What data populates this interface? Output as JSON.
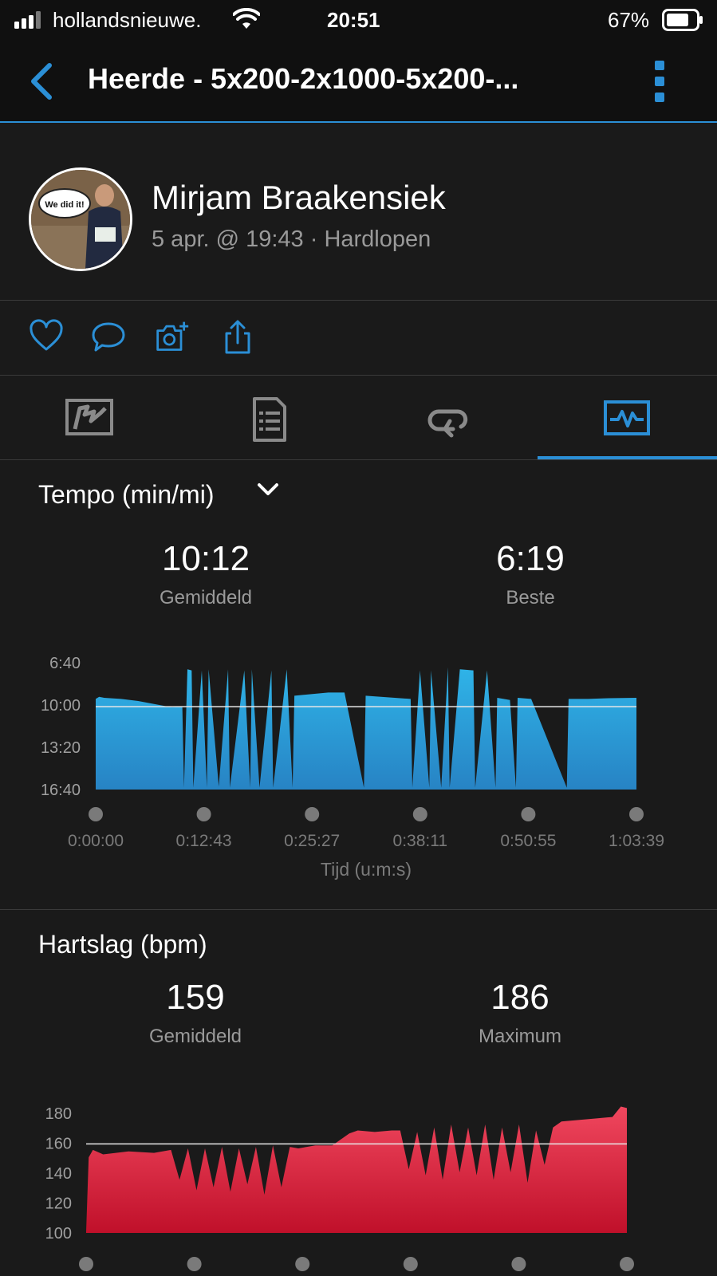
{
  "status_bar": {
    "carrier": "hollandsnieuwe.",
    "time": "20:51",
    "battery": "67%"
  },
  "nav": {
    "title": "Heerde - 5x200-2x1000-5x200-..."
  },
  "activity": {
    "user_name": "Mirjam Braakensiek",
    "meta": "5 apr. @ 19:43 · Hardlopen",
    "avatar_text": "We did it!"
  },
  "actions": [
    "heart-icon",
    "comment-icon",
    "add-photo-icon",
    "share-icon"
  ],
  "tabs": [
    {
      "icon": "activity-map-icon",
      "active": false
    },
    {
      "icon": "details-document-icon",
      "active": false
    },
    {
      "icon": "laps-loop-icon",
      "active": false
    },
    {
      "icon": "charts-icon",
      "active": true
    }
  ],
  "colors": {
    "accent": "#2b8fd6",
    "pace_fill": "#2aa8e0",
    "hr_fill": "#e0263f",
    "background": "#1a1a1a"
  },
  "pace": {
    "title": "Tempo (min/mi)",
    "avg_value": "10:12",
    "avg_label": "Gemiddeld",
    "best_value": "6:19",
    "best_label": "Beste"
  },
  "heart_rate": {
    "title": "Hartslag (bpm)",
    "avg_value": "159",
    "avg_label": "Gemiddeld",
    "max_value": "186",
    "max_label": "Maximum"
  },
  "chart_data": [
    {
      "type": "area",
      "title": "Tempo (min/mi)",
      "xlabel": "Tijd (u:m:s)",
      "ylabel": "",
      "x_ticks": [
        "0:00:00",
        "0:12:43",
        "0:25:27",
        "0:38:11",
        "0:50:55",
        "1:03:39"
      ],
      "y_ticks": [
        "6:40",
        "10:00",
        "13:20",
        "16:40"
      ],
      "y_inverted": true,
      "ylim_seconds": [
        400,
        1000
      ],
      "average_line_seconds": 612,
      "x_minutes": [
        0,
        0.4,
        1,
        3,
        5,
        7,
        9,
        10.2,
        10.4,
        10.8,
        11.3,
        11.5,
        12.5,
        13.1,
        13.3,
        14.5,
        15.6,
        15.8,
        17.5,
        18.2,
        18.4,
        19.3,
        20.7,
        20.9,
        22.5,
        23.2,
        23.4,
        27.4,
        29.3,
        31.6,
        31.8,
        37.1,
        37.3,
        38.2,
        39.3,
        39.5,
        40.7,
        41.5,
        41.7,
        42.9,
        44.5,
        44.7,
        46.1,
        47.1,
        47.3,
        48.8,
        49.5,
        49.7,
        51.3,
        55.5,
        55.7,
        58,
        60,
        63.7
      ],
      "y_seconds": [
        575,
        565,
        570,
        575,
        585,
        600,
        615,
        610,
        995,
        435,
        440,
        995,
        440,
        995,
        435,
        990,
        435,
        995,
        440,
        995,
        435,
        995,
        440,
        995,
        435,
        995,
        560,
        545,
        545,
        995,
        560,
        575,
        995,
        440,
        995,
        440,
        995,
        425,
        995,
        435,
        440,
        995,
        440,
        995,
        570,
        580,
        995,
        570,
        575,
        995,
        575,
        575,
        572,
        570
      ]
    },
    {
      "type": "area",
      "title": "Hartslag (bpm)",
      "xlabel": "",
      "ylabel": "",
      "y_ticks": [
        "180",
        "160",
        "140",
        "120",
        "100"
      ],
      "ylim": [
        100,
        180
      ],
      "average_line": 159,
      "x_minutes": [
        0,
        0.3,
        0.8,
        2,
        5,
        8,
        10,
        11,
        12,
        13,
        14,
        15,
        16,
        17,
        18,
        19,
        20,
        21,
        22,
        23,
        24,
        25,
        27,
        29,
        30,
        31,
        32,
        34,
        36,
        37,
        38,
        39,
        40,
        41,
        42,
        43,
        44,
        45,
        46,
        47,
        48,
        49,
        50,
        51,
        52,
        53,
        54,
        55,
        56,
        58,
        60,
        62,
        63,
        63.7
      ],
      "values": [
        100,
        150,
        155,
        152,
        154,
        153,
        155,
        135,
        156,
        128,
        156,
        130,
        157,
        127,
        156,
        132,
        157,
        125,
        158,
        130,
        157,
        156,
        158,
        158,
        162,
        166,
        168,
        167,
        168,
        168,
        142,
        167,
        138,
        170,
        135,
        172,
        140,
        170,
        138,
        172,
        135,
        170,
        140,
        172,
        133,
        168,
        145,
        170,
        174,
        175,
        176,
        177,
        184,
        183
      ]
    }
  ]
}
